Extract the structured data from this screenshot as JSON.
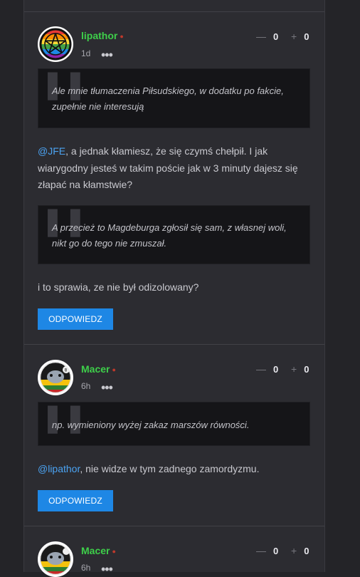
{
  "comments": [
    {
      "username": "lipathor",
      "time": "1d",
      "minus_symbol": "—",
      "minus_count": "0",
      "plus_symbol": "+",
      "plus_count": "0",
      "quote_1": "Ale mnie tłumaczenia Piłsudskiego, w dodatku po fakcie, zupełnie nie interesują",
      "body_1_mention": "@JFE",
      "body_1": ", a jednak kłamiesz, że się czymś chełpił. I jak wiarygodny jesteś w takim poście jak w 3 minuty dajesz się złapać na kłamstwie?",
      "quote_2": "A przecież to Magdeburga zgłosił się sam, z własnej woli, nikt go do tego nie zmuszał.",
      "body_2": "i to sprawia, ze nie był odizolowany?",
      "reply_label": "ODPOWIEDZ"
    },
    {
      "username": "Macer",
      "time": "6h",
      "minus_symbol": "—",
      "minus_count": "0",
      "plus_symbol": "+",
      "plus_count": "0",
      "quote_1": "np. wymieniony wyżej zakaz marszów równości.",
      "body_1_mention": "@lipathor",
      "body_1": ", nie widze w tym zadnego zamordyzmu.",
      "reply_label": "ODPOWIEDZ"
    },
    {
      "username": "Macer",
      "time": "6h",
      "minus_symbol": "—",
      "minus_count": "0",
      "plus_symbol": "+",
      "plus_count": "0"
    }
  ],
  "more_glyph": "•••",
  "quote_glyph": "❚❚",
  "colors": {
    "username": "#3ecf4a",
    "mention": "#4ba3f2",
    "reply_button": "#1e87e5",
    "quote_bg": "#151518"
  }
}
